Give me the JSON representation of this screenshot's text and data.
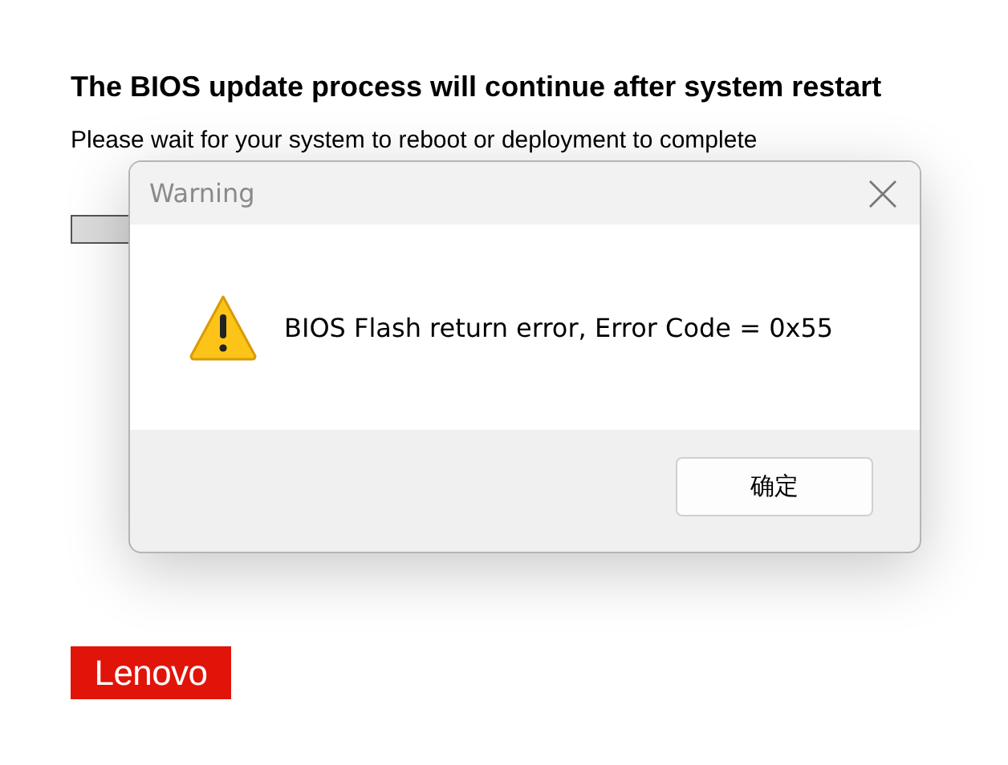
{
  "page": {
    "heading": "The BIOS update process will continue after system restart",
    "subtitle": "Please wait for your system to reboot or deployment to complete"
  },
  "logo": {
    "text": "Lenovo"
  },
  "dialog": {
    "title": "Warning",
    "message": "BIOS Flash return error,  Error Code = 0x55",
    "buttons": [
      {
        "label": "确定"
      }
    ]
  }
}
